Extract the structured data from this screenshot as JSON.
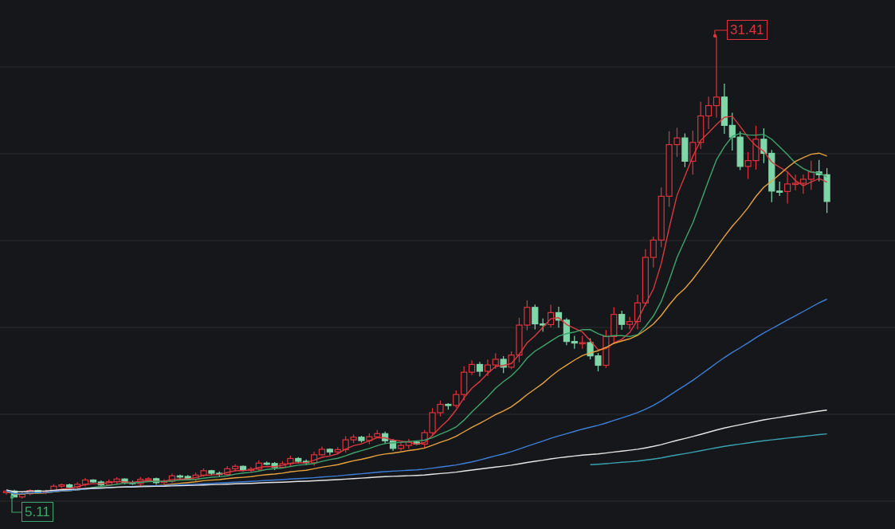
{
  "chart": {
    "price_markers": [
      {
        "kind": "high",
        "text": "31.41"
      },
      {
        "kind": "low",
        "text": "5.11"
      }
    ]
  }
}
